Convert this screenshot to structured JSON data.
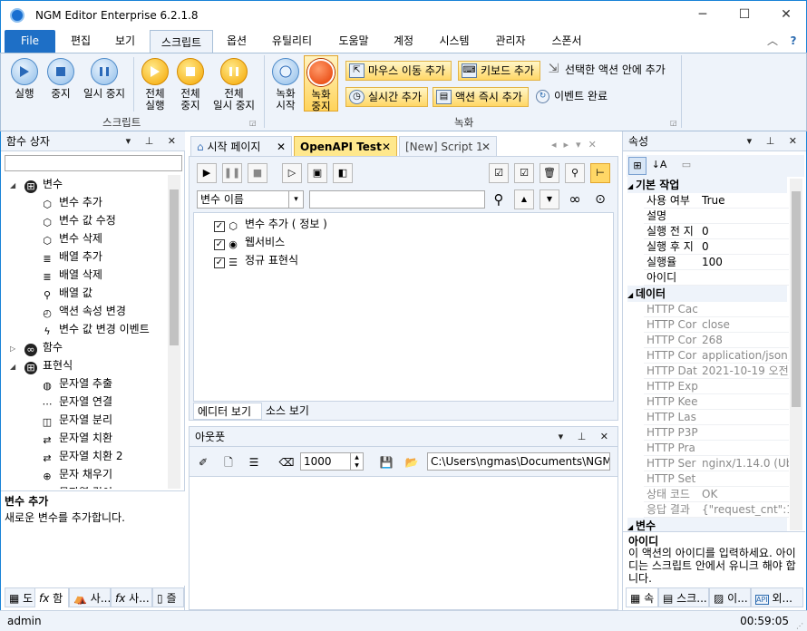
{
  "window": {
    "app_name": "NGM Editor",
    "edition": "Enterprise 6.2.1.8",
    "minimize": "─",
    "maximize": "☐",
    "close": "✕"
  },
  "menu": {
    "file": "File",
    "items": [
      "편집",
      "보기",
      "스크립트",
      "옵션",
      "유틸리티",
      "도움말",
      "계정",
      "시스템",
      "관리자",
      "스폰서"
    ],
    "collapse": "︿",
    "help": "?"
  },
  "ribbon": {
    "script_group": {
      "label": "스크립트",
      "run": "실행",
      "stop": "중지",
      "pause": "일시 중지",
      "run_all_1": "전체",
      "run_all_2": "실행",
      "stop_all_1": "전체",
      "stop_all_2": "중지",
      "pause_all_1": "전체",
      "pause_all_2": "일시 중지"
    },
    "record_group": {
      "label": "녹화",
      "rec_start_1": "녹화",
      "rec_start_2": "시작",
      "rec_stop_1": "녹화",
      "rec_stop_2": "중지",
      "mouse_move": "마우스 이동 추가",
      "keyboard": "키보드 추가",
      "in_selected": "선택한 액션 안에 추가",
      "realtime": "실시간 추가",
      "action_now": "액션 즉시 추가",
      "event_done": "이벤트 완료"
    }
  },
  "left_panel": {
    "title": "함수 상자",
    "tree": [
      {
        "label": "변수",
        "icon": "⊞",
        "level": 0,
        "expander": "◢"
      },
      {
        "label": "변수 추가",
        "icon": "⬡",
        "level": 1
      },
      {
        "label": "변수 값 수정",
        "icon": "⬡",
        "level": 1
      },
      {
        "label": "변수 삭제",
        "icon": "⬡",
        "level": 1
      },
      {
        "label": "배열 추가",
        "icon": "≣",
        "level": 1
      },
      {
        "label": "배열 삭제",
        "icon": "≣",
        "level": 1
      },
      {
        "label": "배열 값",
        "icon": "⚲",
        "level": 1
      },
      {
        "label": "액션 속성 변경",
        "icon": "◴",
        "level": 1
      },
      {
        "label": "변수 값 변경 이벤트",
        "icon": "ϟ",
        "level": 1
      },
      {
        "label": "함수",
        "icon": "∞",
        "level": 0,
        "expander": "▷"
      },
      {
        "label": "표현식",
        "icon": "⊞",
        "level": 0,
        "expander": "◢"
      },
      {
        "label": "문자열 추출",
        "icon": "◍",
        "level": 1
      },
      {
        "label": "문자열 연결",
        "icon": "⋯",
        "level": 1
      },
      {
        "label": "문자열 분리",
        "icon": "◫",
        "level": 1
      },
      {
        "label": "문자열 치환",
        "icon": "⇄",
        "level": 1
      },
      {
        "label": "문자열 치환 2",
        "icon": "⇄",
        "level": 1
      },
      {
        "label": "문자 채우기",
        "icon": "⊕",
        "level": 1
      },
      {
        "label": "문자열 길이",
        "icon": "⊟",
        "level": 1
      }
    ],
    "desc_title": "변수 추가",
    "desc_text": "새로운 변수를 추가합니다.",
    "bottom_tabs": [
      "도",
      "함",
      "사...",
      "사...",
      "즐"
    ]
  },
  "doc_tabs": [
    {
      "label": "시작 페이지",
      "close": "✕"
    },
    {
      "label": "OpenAPI Test",
      "close": "✕"
    },
    {
      "label": "[New] Script 1",
      "close": "✕"
    }
  ],
  "editor": {
    "filter_select": "변수 이름",
    "search_value": "",
    "items": [
      {
        "label": "변수 추가 ( 정보 )",
        "icon": "⬡",
        "checked": "✓"
      },
      {
        "label": "웹서비스",
        "icon": "◉",
        "checked": "✓"
      },
      {
        "label": "정규 표현식",
        "icon": "☰",
        "checked": "✓"
      }
    ],
    "view_tabs": [
      "에디터 보기",
      "소스 보기"
    ]
  },
  "output": {
    "title": "아웃풋",
    "limit": "1000",
    "path": "C:\\Users\\ngmas\\Documents\\NGM6\\"
  },
  "props": {
    "title": "속성",
    "categories": {
      "basic": "기본 작업",
      "data": "데이터",
      "var": "변수"
    },
    "basic_rows": [
      {
        "k": "사용 여부",
        "v": "True"
      },
      {
        "k": "설명",
        "v": ""
      },
      {
        "k": "실행 전 지",
        "v": "0"
      },
      {
        "k": "실행 후 지",
        "v": "0"
      },
      {
        "k": "실행율",
        "v": "100"
      },
      {
        "k": "아이디",
        "v": ""
      }
    ],
    "data_rows": [
      {
        "k": "HTTP Cac",
        "v": ""
      },
      {
        "k": "HTTP Cor",
        "v": "close"
      },
      {
        "k": "HTTP Cor",
        "v": "268"
      },
      {
        "k": "HTTP Cor",
        "v": "application/json;"
      },
      {
        "k": "HTTP Dat",
        "v": "2021-10-19 오전"
      },
      {
        "k": "HTTP Exp",
        "v": ""
      },
      {
        "k": "HTTP Kee",
        "v": ""
      },
      {
        "k": "HTTP Las",
        "v": ""
      },
      {
        "k": "HTTP P3P",
        "v": ""
      },
      {
        "k": "HTTP Pra",
        "v": ""
      },
      {
        "k": "HTTP Ser",
        "v": "nginx/1.14.0 (Ubu"
      },
      {
        "k": "HTTP Set",
        "v": ""
      },
      {
        "k": "상태 코드",
        "v": "OK"
      },
      {
        "k": "응답 결과",
        "v": "{\"request_cnt\":1,"
      }
    ],
    "desc_title": "아이디",
    "desc_text": "이 액션의 아이디를 입력하세요. 아이디는 스크립트 안에서 유니크 해야 합니다.",
    "bottom_tabs": [
      "속",
      "스크...",
      "이...",
      "외..."
    ]
  },
  "status": {
    "user": "admin",
    "time": "00:59:05"
  }
}
